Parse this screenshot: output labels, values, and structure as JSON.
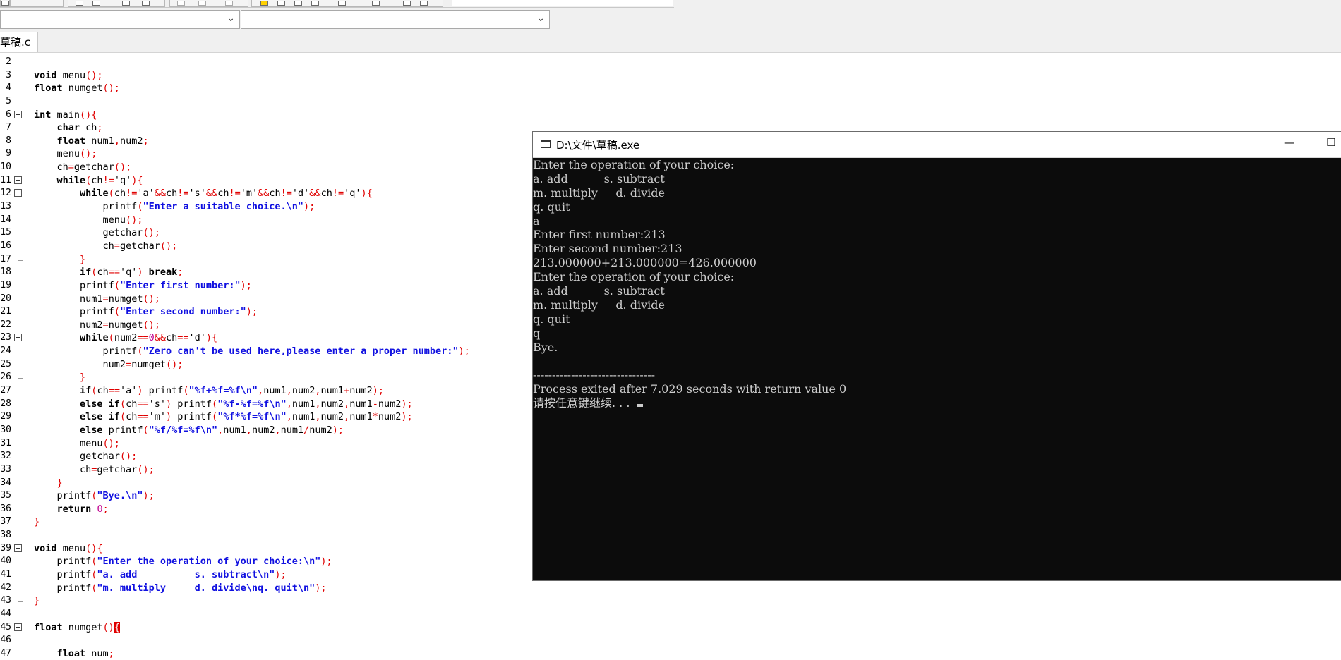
{
  "toolbar": {
    "file_selector_value": "",
    "function_selector_value": ""
  },
  "tab": {
    "label": "草稿.c"
  },
  "editor": {
    "lines": [
      {
        "n": "2",
        "code": []
      },
      {
        "n": "3",
        "code": [
          [
            "kw",
            "void"
          ],
          [
            "t",
            " menu"
          ],
          [
            "sym",
            "();"
          ]
        ]
      },
      {
        "n": "4",
        "code": [
          [
            "kw",
            "float"
          ],
          [
            "t",
            " numget"
          ],
          [
            "sym",
            "();"
          ]
        ]
      },
      {
        "n": "5",
        "code": []
      },
      {
        "n": "6",
        "fold": "open",
        "code": [
          [
            "kw",
            "int"
          ],
          [
            "t",
            " main"
          ],
          [
            "sym",
            "(){"
          ]
        ]
      },
      {
        "n": "7",
        "fold": "line",
        "code": [
          [
            "t",
            "    "
          ],
          [
            "kw",
            "char"
          ],
          [
            "t",
            " ch"
          ],
          [
            "sym",
            ";"
          ]
        ]
      },
      {
        "n": "8",
        "fold": "line",
        "code": [
          [
            "t",
            "    "
          ],
          [
            "kw",
            "float"
          ],
          [
            "t",
            " num1"
          ],
          [
            "sym",
            ","
          ],
          [
            "t",
            "num2"
          ],
          [
            "sym",
            ";"
          ]
        ]
      },
      {
        "n": "9",
        "fold": "line",
        "code": [
          [
            "t",
            "    menu"
          ],
          [
            "sym",
            "();"
          ]
        ]
      },
      {
        "n": "10",
        "fold": "line",
        "code": [
          [
            "t",
            "    ch"
          ],
          [
            "sym",
            "="
          ],
          [
            "t",
            "getchar"
          ],
          [
            "sym",
            "();"
          ]
        ]
      },
      {
        "n": "11",
        "fold": "open",
        "code": [
          [
            "t",
            "    "
          ],
          [
            "kw",
            "while"
          ],
          [
            "sym",
            "("
          ],
          [
            "t",
            "ch"
          ],
          [
            "sym",
            "!="
          ],
          [
            "t",
            "'q'"
          ],
          [
            "sym",
            "){"
          ]
        ]
      },
      {
        "n": "12",
        "fold": "open",
        "code": [
          [
            "t",
            "        "
          ],
          [
            "kw",
            "while"
          ],
          [
            "sym",
            "("
          ],
          [
            "t",
            "ch"
          ],
          [
            "sym",
            "!="
          ],
          [
            "t",
            "'a'"
          ],
          [
            "sym",
            "&&"
          ],
          [
            "t",
            "ch"
          ],
          [
            "sym",
            "!="
          ],
          [
            "t",
            "'s'"
          ],
          [
            "sym",
            "&&"
          ],
          [
            "t",
            "ch"
          ],
          [
            "sym",
            "!="
          ],
          [
            "t",
            "'m'"
          ],
          [
            "sym",
            "&&"
          ],
          [
            "t",
            "ch"
          ],
          [
            "sym",
            "!="
          ],
          [
            "t",
            "'d'"
          ],
          [
            "sym",
            "&&"
          ],
          [
            "t",
            "ch"
          ],
          [
            "sym",
            "!="
          ],
          [
            "t",
            "'q'"
          ],
          [
            "sym",
            "){"
          ]
        ]
      },
      {
        "n": "13",
        "fold": "line",
        "code": [
          [
            "t",
            "            printf"
          ],
          [
            "sym",
            "("
          ],
          [
            "str",
            "\"Enter a suitable choice.\\n\""
          ],
          [
            "sym",
            ");"
          ]
        ]
      },
      {
        "n": "14",
        "fold": "line",
        "code": [
          [
            "t",
            "            menu"
          ],
          [
            "sym",
            "();"
          ]
        ]
      },
      {
        "n": "15",
        "fold": "line",
        "code": [
          [
            "t",
            "            getchar"
          ],
          [
            "sym",
            "();"
          ]
        ]
      },
      {
        "n": "16",
        "fold": "line",
        "code": [
          [
            "t",
            "            ch"
          ],
          [
            "sym",
            "="
          ],
          [
            "t",
            "getchar"
          ],
          [
            "sym",
            "();"
          ]
        ]
      },
      {
        "n": "17",
        "fold": "end",
        "code": [
          [
            "t",
            "        "
          ],
          [
            "sym",
            "}"
          ]
        ]
      },
      {
        "n": "18",
        "fold": "line",
        "code": [
          [
            "t",
            "        "
          ],
          [
            "kw",
            "if"
          ],
          [
            "sym",
            "("
          ],
          [
            "t",
            "ch"
          ],
          [
            "sym",
            "=="
          ],
          [
            "t",
            "'q'"
          ],
          [
            "sym",
            ")"
          ],
          [
            "t",
            " "
          ],
          [
            "kw",
            "break"
          ],
          [
            "sym",
            ";"
          ]
        ]
      },
      {
        "n": "19",
        "fold": "line",
        "code": [
          [
            "t",
            "        printf"
          ],
          [
            "sym",
            "("
          ],
          [
            "str",
            "\"Enter first number:\""
          ],
          [
            "sym",
            ");"
          ]
        ]
      },
      {
        "n": "20",
        "fold": "line",
        "code": [
          [
            "t",
            "        num1"
          ],
          [
            "sym",
            "="
          ],
          [
            "t",
            "numget"
          ],
          [
            "sym",
            "();"
          ]
        ]
      },
      {
        "n": "21",
        "fold": "line",
        "code": [
          [
            "t",
            "        printf"
          ],
          [
            "sym",
            "("
          ],
          [
            "str",
            "\"Enter second number:\""
          ],
          [
            "sym",
            ");"
          ]
        ]
      },
      {
        "n": "22",
        "fold": "line",
        "code": [
          [
            "t",
            "        num2"
          ],
          [
            "sym",
            "="
          ],
          [
            "t",
            "numget"
          ],
          [
            "sym",
            "();"
          ]
        ]
      },
      {
        "n": "23",
        "fold": "open",
        "code": [
          [
            "t",
            "        "
          ],
          [
            "kw",
            "while"
          ],
          [
            "sym",
            "("
          ],
          [
            "t",
            "num2"
          ],
          [
            "sym",
            "=="
          ],
          [
            "num",
            "0"
          ],
          [
            "sym",
            "&&"
          ],
          [
            "t",
            "ch"
          ],
          [
            "sym",
            "=="
          ],
          [
            "t",
            "'d'"
          ],
          [
            "sym",
            "){"
          ]
        ]
      },
      {
        "n": "24",
        "fold": "line",
        "code": [
          [
            "t",
            "            printf"
          ],
          [
            "sym",
            "("
          ],
          [
            "str",
            "\"Zero can't be used here,please enter a proper number:\""
          ],
          [
            "sym",
            ");"
          ]
        ]
      },
      {
        "n": "25",
        "fold": "line",
        "code": [
          [
            "t",
            "            num2"
          ],
          [
            "sym",
            "="
          ],
          [
            "t",
            "numget"
          ],
          [
            "sym",
            "();"
          ]
        ]
      },
      {
        "n": "26",
        "fold": "end",
        "code": [
          [
            "t",
            "        "
          ],
          [
            "sym",
            "}"
          ]
        ]
      },
      {
        "n": "27",
        "fold": "line",
        "code": [
          [
            "t",
            "        "
          ],
          [
            "kw",
            "if"
          ],
          [
            "sym",
            "("
          ],
          [
            "t",
            "ch"
          ],
          [
            "sym",
            "=="
          ],
          [
            "t",
            "'a'"
          ],
          [
            "sym",
            ")"
          ],
          [
            "t",
            " printf"
          ],
          [
            "sym",
            "("
          ],
          [
            "str",
            "\"%f+%f=%f\\n\""
          ],
          [
            "sym",
            ","
          ],
          [
            "t",
            "num1"
          ],
          [
            "sym",
            ","
          ],
          [
            "t",
            "num2"
          ],
          [
            "sym",
            ","
          ],
          [
            "t",
            "num1"
          ],
          [
            "sym",
            "+"
          ],
          [
            "t",
            "num2"
          ],
          [
            "sym",
            ");"
          ]
        ]
      },
      {
        "n": "28",
        "fold": "line",
        "code": [
          [
            "t",
            "        "
          ],
          [
            "kw",
            "else if"
          ],
          [
            "sym",
            "("
          ],
          [
            "t",
            "ch"
          ],
          [
            "sym",
            "=="
          ],
          [
            "t",
            "'s'"
          ],
          [
            "sym",
            ")"
          ],
          [
            "t",
            " printf"
          ],
          [
            "sym",
            "("
          ],
          [
            "str",
            "\"%f-%f=%f\\n\""
          ],
          [
            "sym",
            ","
          ],
          [
            "t",
            "num1"
          ],
          [
            "sym",
            ","
          ],
          [
            "t",
            "num2"
          ],
          [
            "sym",
            ","
          ],
          [
            "t",
            "num1"
          ],
          [
            "sym",
            "-"
          ],
          [
            "t",
            "num2"
          ],
          [
            "sym",
            ");"
          ]
        ]
      },
      {
        "n": "29",
        "fold": "line",
        "code": [
          [
            "t",
            "        "
          ],
          [
            "kw",
            "else if"
          ],
          [
            "sym",
            "("
          ],
          [
            "t",
            "ch"
          ],
          [
            "sym",
            "=="
          ],
          [
            "t",
            "'m'"
          ],
          [
            "sym",
            ")"
          ],
          [
            "t",
            " printf"
          ],
          [
            "sym",
            "("
          ],
          [
            "str",
            "\"%f*%f=%f\\n\""
          ],
          [
            "sym",
            ","
          ],
          [
            "t",
            "num1"
          ],
          [
            "sym",
            ","
          ],
          [
            "t",
            "num2"
          ],
          [
            "sym",
            ","
          ],
          [
            "t",
            "num1"
          ],
          [
            "sym",
            "*"
          ],
          [
            "t",
            "num2"
          ],
          [
            "sym",
            ");"
          ]
        ]
      },
      {
        "n": "30",
        "fold": "line",
        "code": [
          [
            "t",
            "        "
          ],
          [
            "kw",
            "else"
          ],
          [
            "t",
            " printf"
          ],
          [
            "sym",
            "("
          ],
          [
            "str",
            "\"%f/%f=%f\\n\""
          ],
          [
            "sym",
            ","
          ],
          [
            "t",
            "num1"
          ],
          [
            "sym",
            ","
          ],
          [
            "t",
            "num2"
          ],
          [
            "sym",
            ","
          ],
          [
            "t",
            "num1"
          ],
          [
            "sym",
            "/"
          ],
          [
            "t",
            "num2"
          ],
          [
            "sym",
            ");"
          ]
        ]
      },
      {
        "n": "31",
        "fold": "line",
        "code": [
          [
            "t",
            "        menu"
          ],
          [
            "sym",
            "();"
          ]
        ]
      },
      {
        "n": "32",
        "fold": "line",
        "code": [
          [
            "t",
            "        getchar"
          ],
          [
            "sym",
            "();"
          ]
        ]
      },
      {
        "n": "33",
        "fold": "line",
        "code": [
          [
            "t",
            "        ch"
          ],
          [
            "sym",
            "="
          ],
          [
            "t",
            "getchar"
          ],
          [
            "sym",
            "();"
          ]
        ]
      },
      {
        "n": "34",
        "fold": "end",
        "code": [
          [
            "t",
            "    "
          ],
          [
            "sym",
            "}"
          ]
        ]
      },
      {
        "n": "35",
        "fold": "line",
        "code": [
          [
            "t",
            "    printf"
          ],
          [
            "sym",
            "("
          ],
          [
            "str",
            "\"Bye.\\n\""
          ],
          [
            "sym",
            ");"
          ]
        ]
      },
      {
        "n": "36",
        "fold": "line",
        "code": [
          [
            "t",
            "    "
          ],
          [
            "kw",
            "return"
          ],
          [
            "t",
            " "
          ],
          [
            "num",
            "0"
          ],
          [
            "sym",
            ";"
          ]
        ]
      },
      {
        "n": "37",
        "fold": "end",
        "code": [
          [
            "sym",
            "}"
          ]
        ]
      },
      {
        "n": "38",
        "code": []
      },
      {
        "n": "39",
        "fold": "open",
        "code": [
          [
            "kw",
            "void"
          ],
          [
            "t",
            " menu"
          ],
          [
            "sym",
            "(){"
          ]
        ]
      },
      {
        "n": "40",
        "fold": "line",
        "code": [
          [
            "t",
            "    printf"
          ],
          [
            "sym",
            "("
          ],
          [
            "str",
            "\"Enter the operation of your choice:\\n\""
          ],
          [
            "sym",
            ");"
          ]
        ]
      },
      {
        "n": "41",
        "fold": "line",
        "code": [
          [
            "t",
            "    printf"
          ],
          [
            "sym",
            "("
          ],
          [
            "str",
            "\"a. add          s. subtract\\n\""
          ],
          [
            "sym",
            ");"
          ]
        ]
      },
      {
        "n": "42",
        "fold": "line",
        "code": [
          [
            "t",
            "    printf"
          ],
          [
            "sym",
            "("
          ],
          [
            "str",
            "\"m. multiply     d. divide\\nq. quit\\n\""
          ],
          [
            "sym",
            ");"
          ]
        ]
      },
      {
        "n": "43",
        "fold": "end",
        "code": [
          [
            "sym",
            "}"
          ]
        ]
      },
      {
        "n": "44",
        "code": []
      },
      {
        "n": "45",
        "fold": "open",
        "code": [
          [
            "kw",
            "float"
          ],
          [
            "t",
            " numget"
          ],
          [
            "sym",
            "()"
          ],
          [
            "cur",
            "{"
          ]
        ]
      },
      {
        "n": "46",
        "fold": "line",
        "code": []
      },
      {
        "n": "47",
        "fold": "line",
        "code": [
          [
            "t",
            "    "
          ],
          [
            "kw",
            "float"
          ],
          [
            "t",
            " num"
          ],
          [
            "sym",
            ";"
          ]
        ]
      }
    ]
  },
  "console": {
    "title": "D:\\文件\\草稿.exe",
    "minimize_glyph": "—",
    "maximize_glyph": "☐",
    "lines": [
      "Enter the operation of your choice:",
      "a. add          s. subtract",
      "m. multiply     d. divide",
      "q. quit",
      "a",
      "Enter first number:213",
      "Enter second number:213",
      "213.000000+213.000000=426.000000",
      "Enter the operation of your choice:",
      "a. add          s. subtract",
      "m. multiply     d. divide",
      "q. quit",
      "q",
      "Bye.",
      "",
      "--------------------------------",
      "Process exited after 7.029 seconds with return value 0",
      "请按任意键继续. . . "
    ]
  }
}
